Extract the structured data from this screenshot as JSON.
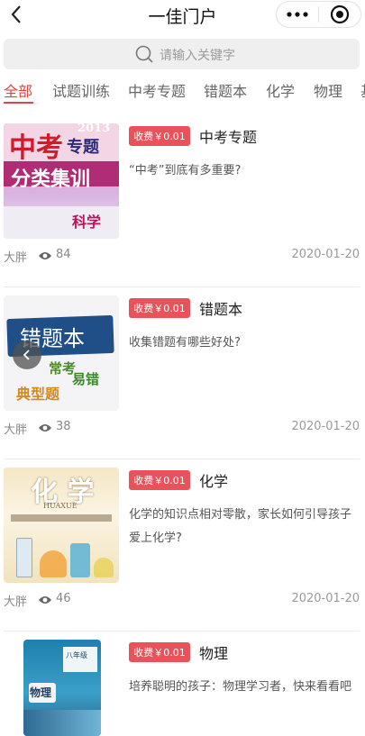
{
  "nav": {
    "title": "一佳门户",
    "back_icon": "back-chevron-icon",
    "more_icon": "more-dots-icon",
    "close_icon": "target-close-icon"
  },
  "search": {
    "placeholder": "请输入关键字"
  },
  "tabs": [
    "全部",
    "试题训练",
    "中考专题",
    "错题本",
    "化学",
    "物理",
    "基"
  ],
  "active_tab": 0,
  "colors": {
    "accent": "#e24343",
    "badge": "#e9525a"
  },
  "articles": [
    {
      "badge": "收费￥0.01",
      "title": "中考专题",
      "desc": "“中考”到底有多重要?",
      "author": "大胖",
      "views": "84",
      "date": "2020-01-20",
      "thumb": {
        "l1": "中考",
        "l2": "专题",
        "l3": "分类集训",
        "l4": "科学",
        "year": "2013"
      }
    },
    {
      "badge": "收费￥0.01",
      "title": "错题本",
      "desc": "收集错题有哪些好处?",
      "author": "大胖",
      "views": "38",
      "date": "2020-01-20",
      "thumb": {
        "l1": "错题本",
        "l2": "常考",
        "l3": "易错",
        "l4": "典型题"
      }
    },
    {
      "badge": "收费￥0.01",
      "title": "化学",
      "desc": "化学的知识点相对零散，家长如何引导孩子爱上化学?",
      "author": "大胖",
      "views": "46",
      "date": "2020-01-20",
      "thumb": {
        "l1": "化 学",
        "l2": "HUAXUE"
      }
    },
    {
      "badge": "收费￥0.01",
      "title": "物理",
      "desc": "培养聪明的孩子：物理学习者，快来看看吧",
      "author": "",
      "views": "",
      "date": "",
      "thumb": {
        "l1": "物理",
        "l2": "八年级"
      }
    }
  ]
}
